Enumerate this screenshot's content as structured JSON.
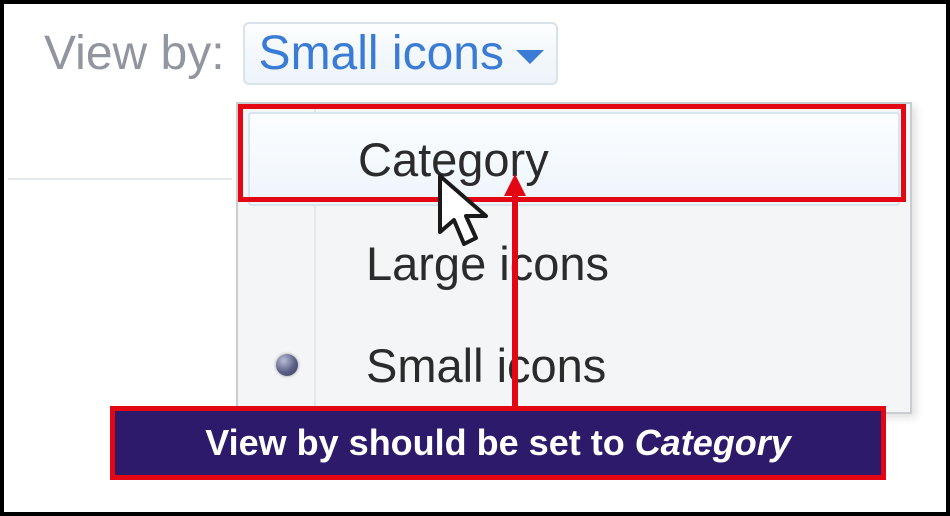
{
  "view_by": {
    "label": "View by:",
    "selected": "Small icons"
  },
  "menu": {
    "items": [
      {
        "label": "Category",
        "selected": false,
        "hovered": true
      },
      {
        "label": "Large icons",
        "selected": false,
        "hovered": false
      },
      {
        "label": "Small icons",
        "selected": true,
        "hovered": false
      }
    ]
  },
  "annotation": {
    "prefix": "View by should be set to ",
    "emphasis": "Category"
  }
}
